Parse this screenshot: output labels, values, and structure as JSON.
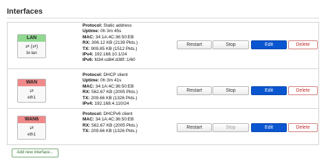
{
  "section": {
    "title": "Interfaces"
  },
  "interfaces": [
    {
      "name": "LAN",
      "badge_color": "#90d890",
      "icons": "⇄ (⇄)",
      "device": "br-lan",
      "protocol_label": "Protocol:",
      "protocol": "Static address",
      "uptime_label": "Uptime:",
      "uptime": "0h 3m 45s",
      "mac_label": "MAC:",
      "mac": "34:1A:4C:36:50:EB",
      "rx_label": "RX:",
      "rx": "306.12 KB (2139 Pkts.)",
      "tx_label": "TX:",
      "tx": "909.85 KB (1512 Pkts.)",
      "ipv4_label": "IPv4:",
      "ipv4": "192.168.10.1/24",
      "ipv6_label": "IPv6:",
      "ipv6": "fd34:cd84:d38f::1/60",
      "buttons": {
        "restart": "Restart",
        "stop": "Stop",
        "edit": "Edit",
        "delete": "Delete"
      }
    },
    {
      "name": "WAN",
      "badge_color": "#f08a8a",
      "icons": "⇄",
      "device": "eth1",
      "protocol_label": "Protocol:",
      "protocol": "DHCP client",
      "uptime_label": "Uptime:",
      "uptime": "0h 3m 41s",
      "mac_label": "MAC:",
      "mac": "34:1A:4C:36:50:EB",
      "rx_label": "RX:",
      "rx": "562.67 KB (2005 Pkts.)",
      "tx_label": "TX:",
      "tx": "209.66 KB (1326 Pkts.)",
      "ipv4_label": "IPv4:",
      "ipv4": "192.168.4.110/24",
      "buttons": {
        "restart": "Restart",
        "stop": "Stop",
        "edit": "Edit",
        "delete": "Delete"
      }
    },
    {
      "name": "WAN6",
      "badge_color": "#f08a8a",
      "icons": "⇄",
      "device": "eth1",
      "protocol_label": "Protocol:",
      "protocol": "DHCPv6 client",
      "mac_label": "MAC:",
      "mac": "34:1A:4C:36:50:EB",
      "rx_label": "RX:",
      "rx": "562.67 KB (2005 Pkts.)",
      "tx_label": "TX:",
      "tx": "209.66 KB (1326 Pkts.)",
      "buttons": {
        "restart": "Restart",
        "stop": "Stop",
        "edit": "Edit",
        "delete": "Delete"
      }
    }
  ],
  "add_button": "Add new interface..."
}
